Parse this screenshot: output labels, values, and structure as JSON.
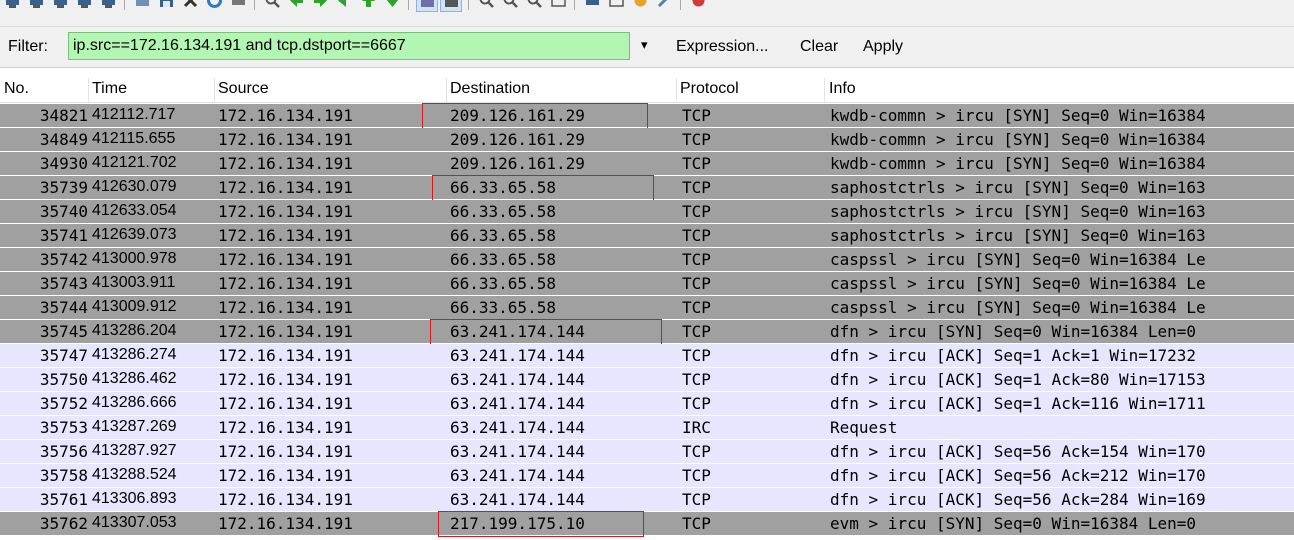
{
  "colors": {
    "row_syn": "#a0a0a0",
    "row_normal": "#e7e6ff",
    "filter_bg": "#b3f5b3",
    "highlight_box": "#d21b1b"
  },
  "toolbar": {
    "icons": [
      "interface-list-icon",
      "capture-options-icon",
      "start-capture-icon",
      "stop-capture-icon",
      "restart-capture-icon",
      "open-file-icon",
      "save-file-icon",
      "close-file-icon",
      "reload-icon",
      "print-icon",
      "find-packet-icon",
      "go-back-icon",
      "go-forward-icon",
      "go-to-packet-icon",
      "go-first-icon",
      "go-last-icon",
      "colorize-icon",
      "auto-scroll-icon",
      "zoom-in-icon",
      "zoom-out-icon",
      "zoom-normal-icon",
      "resize-columns-icon",
      "capture-filters-icon",
      "display-filters-icon",
      "coloring-rules-icon",
      "preferences-icon",
      "help-icon"
    ]
  },
  "filter": {
    "label": "Filter:",
    "value": "ip.src==172.16.134.191 and tcp.dstport==6667",
    "dropdown_icon": "▾",
    "expression_label": "Expression...",
    "clear_label": "Clear",
    "apply_label": "Apply"
  },
  "columns": {
    "no": "No.",
    "time": "Time",
    "source": "Source",
    "destination": "Destination",
    "protocol": "Protocol",
    "info": "Info"
  },
  "packets": [
    {
      "no": "34821",
      "time": "412112.717",
      "src": "172.16.134.191",
      "dst": "209.126.161.29",
      "proto": "TCP",
      "info": "kwdb-commn > ircu [SYN] Seq=0 Win=16384",
      "type": "syn",
      "boxed": true
    },
    {
      "no": "34849",
      "time": "412115.655",
      "src": "172.16.134.191",
      "dst": "209.126.161.29",
      "proto": "TCP",
      "info": "kwdb-commn > ircu [SYN] Seq=0 Win=16384",
      "type": "syn",
      "boxed": false
    },
    {
      "no": "34930",
      "time": "412121.702",
      "src": "172.16.134.191",
      "dst": "209.126.161.29",
      "proto": "TCP",
      "info": "kwdb-commn > ircu [SYN] Seq=0 Win=16384",
      "type": "syn",
      "boxed": false
    },
    {
      "no": "35739",
      "time": "412630.079",
      "src": "172.16.134.191",
      "dst": "66.33.65.58",
      "proto": "TCP",
      "info": "saphostctrls > ircu [SYN] Seq=0 Win=163",
      "type": "syn",
      "boxed": true
    },
    {
      "no": "35740",
      "time": "412633.054",
      "src": "172.16.134.191",
      "dst": "66.33.65.58",
      "proto": "TCP",
      "info": "saphostctrls > ircu [SYN] Seq=0 Win=163",
      "type": "syn",
      "boxed": false
    },
    {
      "no": "35741",
      "time": "412639.073",
      "src": "172.16.134.191",
      "dst": "66.33.65.58",
      "proto": "TCP",
      "info": "saphostctrls > ircu [SYN] Seq=0 Win=163",
      "type": "syn",
      "boxed": false
    },
    {
      "no": "35742",
      "time": "413000.978",
      "src": "172.16.134.191",
      "dst": "66.33.65.58",
      "proto": "TCP",
      "info": "caspssl > ircu [SYN] Seq=0 Win=16384 Le",
      "type": "syn",
      "boxed": false
    },
    {
      "no": "35743",
      "time": "413003.911",
      "src": "172.16.134.191",
      "dst": "66.33.65.58",
      "proto": "TCP",
      "info": "caspssl > ircu [SYN] Seq=0 Win=16384 Le",
      "type": "syn",
      "boxed": false
    },
    {
      "no": "35744",
      "time": "413009.912",
      "src": "172.16.134.191",
      "dst": "66.33.65.58",
      "proto": "TCP",
      "info": "caspssl > ircu [SYN] Seq=0 Win=16384 Le",
      "type": "syn",
      "boxed": false
    },
    {
      "no": "35745",
      "time": "413286.204",
      "src": "172.16.134.191",
      "dst": "63.241.174.144",
      "proto": "TCP",
      "info": "dfn > ircu [SYN] Seq=0 Win=16384 Len=0",
      "type": "syn",
      "boxed": true
    },
    {
      "no": "35747",
      "time": "413286.274",
      "src": "172.16.134.191",
      "dst": "63.241.174.144",
      "proto": "TCP",
      "info": "dfn > ircu [ACK] Seq=1 Ack=1 Win=17232",
      "type": "normal",
      "boxed": false
    },
    {
      "no": "35750",
      "time": "413286.462",
      "src": "172.16.134.191",
      "dst": "63.241.174.144",
      "proto": "TCP",
      "info": "dfn > ircu [ACK] Seq=1 Ack=80 Win=17153",
      "type": "normal",
      "boxed": false
    },
    {
      "no": "35752",
      "time": "413286.666",
      "src": "172.16.134.191",
      "dst": "63.241.174.144",
      "proto": "TCP",
      "info": "dfn > ircu [ACK] Seq=1 Ack=116 Win=1711",
      "type": "normal",
      "boxed": false
    },
    {
      "no": "35753",
      "time": "413287.269",
      "src": "172.16.134.191",
      "dst": "63.241.174.144",
      "proto": "IRC",
      "info": "Request",
      "type": "normal",
      "boxed": false
    },
    {
      "no": "35756",
      "time": "413287.927",
      "src": "172.16.134.191",
      "dst": "63.241.174.144",
      "proto": "TCP",
      "info": "dfn > ircu [ACK] Seq=56 Ack=154 Win=170",
      "type": "normal",
      "boxed": false
    },
    {
      "no": "35758",
      "time": "413288.524",
      "src": "172.16.134.191",
      "dst": "63.241.174.144",
      "proto": "TCP",
      "info": "dfn > ircu [ACK] Seq=56 Ack=212 Win=170",
      "type": "normal",
      "boxed": false
    },
    {
      "no": "35761",
      "time": "413306.893",
      "src": "172.16.134.191",
      "dst": "63.241.174.144",
      "proto": "TCP",
      "info": "dfn > ircu [ACK] Seq=56 Ack=284 Win=169",
      "type": "normal",
      "boxed": false
    },
    {
      "no": "35762",
      "time": "413307.053",
      "src": "172.16.134.191",
      "dst": "217.199.175.10",
      "proto": "TCP",
      "info": "evm > ircu [SYN] Seq=0 Win=16384 Len=0",
      "type": "syn",
      "boxed": true
    }
  ]
}
